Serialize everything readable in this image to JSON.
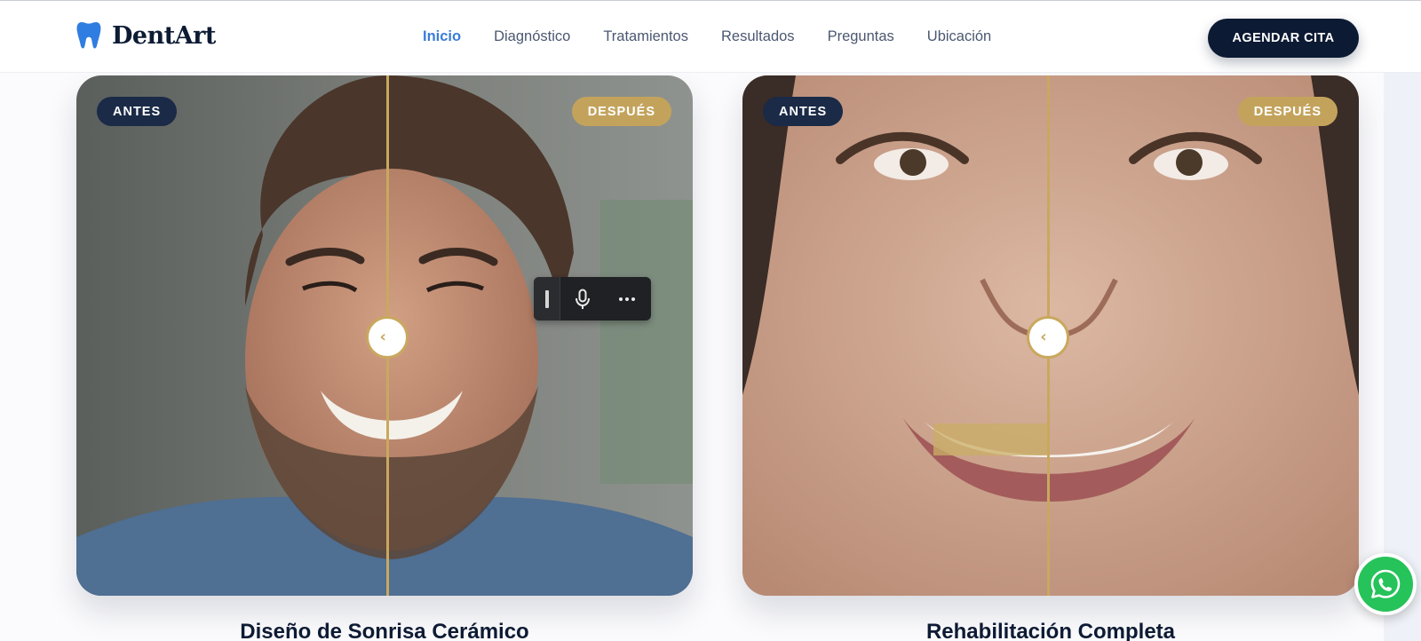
{
  "header": {
    "logo_text": "DentArt",
    "nav": [
      {
        "label": "Inicio",
        "active": true
      },
      {
        "label": "Diagnóstico",
        "active": false
      },
      {
        "label": "Tratamientos",
        "active": false
      },
      {
        "label": "Resultados",
        "active": false
      },
      {
        "label": "Preguntas",
        "active": false
      },
      {
        "label": "Ubicación",
        "active": false
      }
    ],
    "cta_label": "AGENDAR CITA"
  },
  "cases": [
    {
      "before_label": "ANTES",
      "after_label": "DESPUÉS",
      "title": "Diseño de Sonrisa Cerámico",
      "slider_percent": 50.5
    },
    {
      "before_label": "ANTES",
      "after_label": "DESPUÉS",
      "title": "Rehabilitación Completa",
      "slider_percent": 49.6
    }
  ],
  "voice_toolbar": {
    "icons": [
      "drag-handle-icon",
      "microphone-icon",
      "more-options-icon"
    ]
  },
  "whatsapp": {
    "icon": "whatsapp-icon"
  },
  "colors": {
    "primary_dark": "#0c1a33",
    "accent_blue": "#3b7dd8",
    "gold": "#c9a85e",
    "badge_dark": "#1a2a47",
    "whatsapp_green": "#26c25a"
  }
}
